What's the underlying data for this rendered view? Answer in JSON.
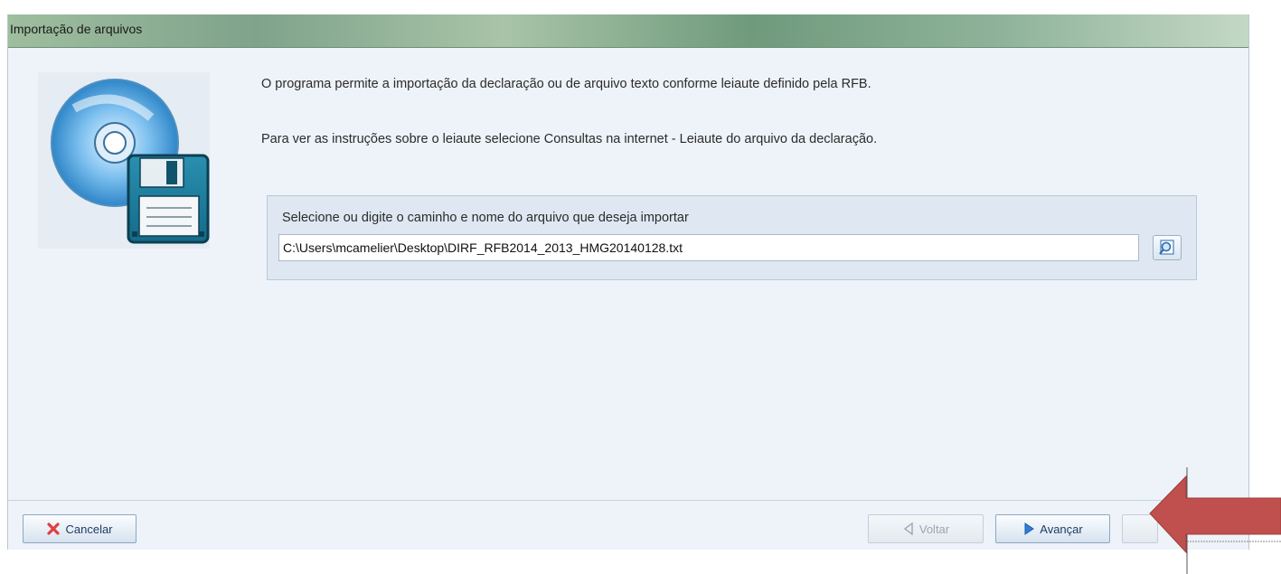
{
  "window": {
    "title": "Importação de arquivos"
  },
  "info": {
    "line1": "O programa permite a importação da declaração ou de arquivo texto conforme leiaute definido pela RFB.",
    "line2": "Para ver as instruções sobre o leiaute selecione Consultas na internet - Leiaute do arquivo da declaração."
  },
  "file": {
    "label": "Selecione ou digite o caminho e nome do arquivo que deseja importar",
    "value": "C:\\Users\\mcamelier\\Desktop\\DIRF_RFB2014_2013_HMG20140128.txt"
  },
  "buttons": {
    "cancel": "Cancelar",
    "back": "Voltar",
    "next": "Avançar"
  },
  "icons": {
    "app": "cd-floppy-import-icon",
    "browse": "browse-file-icon",
    "cancel": "red-x-icon",
    "back": "triangle-left-icon",
    "next": "triangle-right-icon",
    "annotation": "red-arrow"
  },
  "colors": {
    "annotation_arrow": "#c0504d",
    "next_icon": "#2f7fd9",
    "cancel_icon": "#e04040"
  }
}
